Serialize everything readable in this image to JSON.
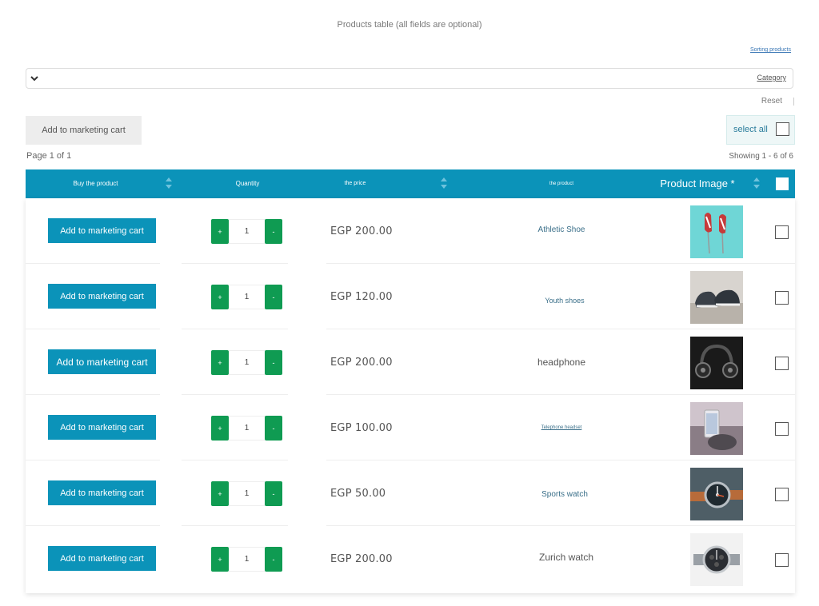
{
  "page": {
    "title": "Products table (all fields are optional)",
    "sorting_link": "Sorting products",
    "category_label": "Category",
    "reset_label": "Reset",
    "top_cart_button": "Add to marketing cart",
    "select_all_label": "select all",
    "page_info": "Page 1 of 1",
    "showing_info": "Showing 1 - 6 of 6"
  },
  "table": {
    "headers": {
      "buy": "Buy the product",
      "quantity": "Quantity",
      "price": "the price",
      "product": "the product",
      "image": "Product Image *"
    },
    "rows": [
      {
        "cart_label": "Add to marketing cart",
        "plus": "+",
        "minus": "-",
        "qty": "1",
        "price": "EGP 200.00",
        "product": "Athletic Shoe",
        "image_icon": "athletic-shoe-image"
      },
      {
        "cart_label": "Add to marketing cart",
        "plus": "+",
        "minus": "-",
        "qty": "1",
        "price": "EGP 120.00",
        "product": "Youth shoes",
        "image_icon": "youth-shoes-image"
      },
      {
        "cart_label": "Add to marketing cart",
        "plus": "+",
        "minus": "-",
        "qty": "1",
        "price": "EGP 200.00",
        "product": "headphone",
        "image_icon": "headphone-image"
      },
      {
        "cart_label": "Add to marketing cart",
        "plus": "+",
        "minus": "-",
        "qty": "1",
        "price": "EGP 100.00",
        "product": "Telephone headset",
        "image_icon": "telephone-headset-image"
      },
      {
        "cart_label": "Add to marketing cart",
        "plus": "+",
        "minus": "-",
        "qty": "1",
        "price": "EGP 50.00",
        "product": "Sports watch",
        "image_icon": "sports-watch-image"
      },
      {
        "cart_label": "Add to marketing cart",
        "plus": "+",
        "minus": "-",
        "qty": "1",
        "price": "EGP 200.00",
        "product": "Zurich watch",
        "image_icon": "zurich-watch-image"
      }
    ]
  },
  "colors": {
    "header_bg": "#0b93b9",
    "cart_button": "#0b93b9",
    "qty_button": "#0f9b52",
    "product_link": "#3a6f89"
  }
}
